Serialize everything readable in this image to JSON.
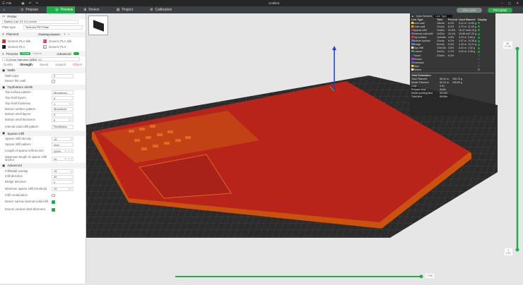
{
  "titlebar": {
    "menu": "File",
    "title": "Untitled"
  },
  "tabs": [
    {
      "label": "Prepare"
    },
    {
      "label": "Preview"
    },
    {
      "label": "Device"
    },
    {
      "label": "Project"
    },
    {
      "label": "Calibration"
    }
  ],
  "actions": {
    "slice_label": "Slice plate",
    "print_label": "Print plate"
  },
  "printer": {
    "section": "Printer",
    "name": "Bambu Lab X1 0.4 nozzle",
    "plate_type_label": "Plate type",
    "plate_type": "Textured PEI Plate"
  },
  "filament": {
    "section": "Filament",
    "flushing": "Flushing volumes",
    "items": [
      {
        "num": "1",
        "name": "Generic PLA Silk",
        "color": "#d42a2a"
      },
      {
        "num": "2",
        "name": "Generic PLA Silk",
        "color": "#d6417a"
      },
      {
        "num": "3",
        "name": "Generic PLA",
        "color": "#111111"
      },
      {
        "num": "4",
        "name": "Generic PLA",
        "color": "#ffffff"
      }
    ]
  },
  "process": {
    "section": "Process",
    "global": "Global",
    "objects": "Objects",
    "advanced": "Advanced",
    "preset": "* 0.20mm Standard @BBL X1",
    "subtabs": [
      "Quality",
      "Strength",
      "Speed",
      "Support",
      "Others"
    ]
  },
  "settings": [
    {
      "section": "Walls",
      "rows": [
        {
          "label": "Wall loops",
          "value": "2"
        },
        {
          "label": "Detect thin wall",
          "check": false
        }
      ]
    },
    {
      "section": "Top/bottom shells",
      "rows": [
        {
          "label": "Top surface pattern",
          "value": "Monotonic..."
        },
        {
          "label": "Top shell layers",
          "value": "5"
        },
        {
          "label": "Top shell thickness",
          "value": "1",
          "unit": "mm"
        },
        {
          "label": "Bottom surface pattern",
          "value": "Monotonic"
        },
        {
          "label": "Bottom shell layers",
          "value": "3"
        },
        {
          "label": "Bottom shell thickness",
          "value": "0",
          "unit": "mm"
        },
        {
          "label": "Internal solid infill pattern",
          "value": "Rectilinear"
        }
      ]
    },
    {
      "section": "Sparse infill",
      "rows": [
        {
          "label": "Sparse infill density",
          "value": "15",
          "unit": "%"
        },
        {
          "label": "Sparse infill pattern",
          "value": "Grid"
        },
        {
          "label": "Length of sparse infill anchor",
          "value": "400%",
          "unit": "mm or %"
        },
        {
          "label": "Maximum length of sparse infill anchor",
          "value": "20",
          "unit": "mm or %"
        }
      ]
    },
    {
      "section": "Advanced",
      "rows": [
        {
          "label": "Infill/Wall overlap",
          "value": "15",
          "unit": "%"
        },
        {
          "label": "Infill direction",
          "value": "45",
          "unit": "°"
        },
        {
          "label": "Bridge direction",
          "value": "0",
          "unit": "°"
        },
        {
          "label": "Minimum sparse infill threshold",
          "value": "15",
          "unit": "mm²"
        },
        {
          "label": "Infill combination",
          "check": false
        },
        {
          "label": "Detect narrow internal solid infill",
          "check": true
        },
        {
          "label": "Ensure vertical shell thickness",
          "check": true
        }
      ]
    }
  ],
  "legend": {
    "color_scheme": "Color Scheme",
    "scheme_value": "Line Type",
    "headers": [
      "Line Type",
      "Time",
      "Percent",
      "Used filament",
      "Display"
    ],
    "rows": [
      {
        "name": "Inner wall",
        "color": "#f5d41f",
        "time": "18m4s",
        "pct": "6.2%",
        "len": "9.41 m",
        "wt": "12.60 g"
      },
      {
        "name": "Outer wall",
        "color": "#f08c22",
        "time": "21m4s",
        "pct": "6.2%",
        "len": "3.72 m",
        "wt": "11.09 g"
      },
      {
        "name": "Sparse infill",
        "color": "#b33d3d",
        "time": "1h46m",
        "pct": "31.8%",
        "len": "16.47 m",
        "wt": "46.15 g"
      },
      {
        "name": "Internal solid infill",
        "color": "#8b4bbf",
        "time": "1h32m",
        "pct": "24.4%",
        "len": "15.68 m",
        "wt": "47.20 g"
      },
      {
        "name": "Top surface",
        "color": "#d93a3a",
        "time": "1h4m8s",
        "pct": "4.8%",
        "len": "3.29 m",
        "wt": "9.80 g"
      },
      {
        "name": "Bottom surface",
        "color": "#5a6bd6",
        "time": "21m4s",
        "pct": "6.2%",
        "len": "3.47 m",
        "wt": "10.35 g"
      },
      {
        "name": "Bridge",
        "color": "#5b87b8",
        "time": "51m4s",
        "pct": "9.3%",
        "len": "4.43 m",
        "wt": "13.21 g"
      },
      {
        "name": "Gap infill",
        "color": "#ffffff",
        "time": "12m13s",
        "pct": "3.6%",
        "len": "0.51 m",
        "wt": "1.52 g"
      },
      {
        "name": "Custom",
        "color": "#2aa85a",
        "time": "4m11s",
        "pct": "1.1%",
        "len": "0.02 m",
        "wt": "0.05 g"
      },
      {
        "name": "Travel",
        "color": "#2f3fae",
        "time": "21m4s",
        "pct": "6.4%",
        "len": "",
        "wt": ""
      },
      {
        "name": "Retract",
        "color": "#c42bd1",
        "time": "",
        "pct": "",
        "len": "",
        "wt": ""
      },
      {
        "name": "Unretract",
        "color": "#4a62cf",
        "time": "",
        "pct": "",
        "len": "",
        "wt": ""
      },
      {
        "name": "Wipe",
        "color": "#f0d020",
        "time": "",
        "pct": "",
        "len": "",
        "wt": ""
      },
      {
        "name": "Seams",
        "color": "#eeeeee",
        "time": "",
        "pct": "",
        "len": "",
        "wt": ""
      }
    ],
    "total_title": "Total Estimation",
    "totals": [
      {
        "label": "Total Filament",
        "a": "56.94 m",
        "b": "165.75 g"
      },
      {
        "label": "Model Filament",
        "a": "52.22 m",
        "b": "155.69 g"
      },
      {
        "label": "Cost",
        "a": "3.61",
        "b": ""
      },
      {
        "label": "Prepare time",
        "a": "4m3s",
        "b": ""
      },
      {
        "label": "Model printing time",
        "a": "5h14m",
        "b": ""
      },
      {
        "label": "Total time",
        "a": "5h18m",
        "b": ""
      }
    ]
  },
  "sliders": {
    "top_layer": "56",
    "top_height": "17.00",
    "bottom_layer": "1",
    "bottom_height": "0.21",
    "move": "1766"
  }
}
